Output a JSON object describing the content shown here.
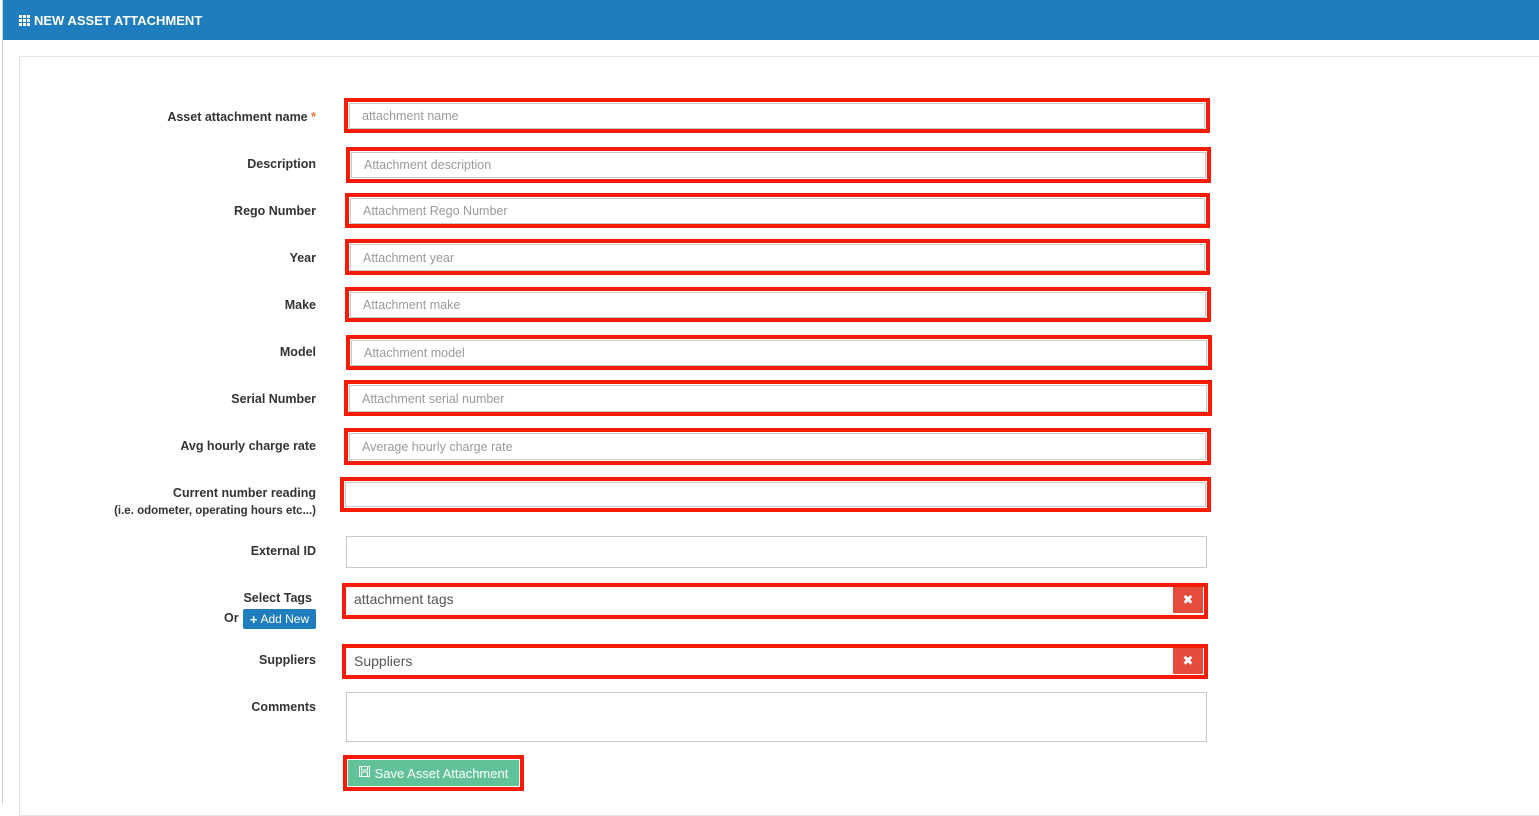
{
  "header": {
    "title": "NEW ASSET ATTACHMENT",
    "icon": "th-grid-icon"
  },
  "form": {
    "name": {
      "label": "Asset attachment name",
      "required_mark": "*",
      "placeholder": "attachment name"
    },
    "description": {
      "label": "Description",
      "placeholder": "Attachment description"
    },
    "rego": {
      "label": "Rego Number",
      "placeholder": "Attachment Rego Number"
    },
    "year": {
      "label": "Year",
      "placeholder": "Attachment year"
    },
    "make": {
      "label": "Make",
      "placeholder": "Attachment make"
    },
    "model": {
      "label": "Model",
      "placeholder": "Attachment model"
    },
    "serial": {
      "label": "Serial Number",
      "placeholder": "Attachment serial number"
    },
    "rate": {
      "label": "Avg hourly charge rate",
      "placeholder": "Average hourly charge rate"
    },
    "reading": {
      "label": "Current number reading",
      "sublabel": "(i.e. odometer, operating hours etc...)",
      "placeholder": ""
    },
    "external_id": {
      "label": "External ID",
      "placeholder": ""
    },
    "tags": {
      "label": "Select Tags",
      "or": "Or",
      "add_new": "Add New",
      "value": "attachment tags",
      "clear": "✖"
    },
    "suppliers": {
      "label": "Suppliers",
      "value": "Suppliers",
      "clear": "✖"
    },
    "comments": {
      "label": "Comments",
      "placeholder": ""
    },
    "save_label": "Save Asset Attachment"
  },
  "colors": {
    "header": "#1f7dbd",
    "highlight": "#f51c03",
    "save": "#61c29a",
    "clear": "#e54c3c"
  }
}
